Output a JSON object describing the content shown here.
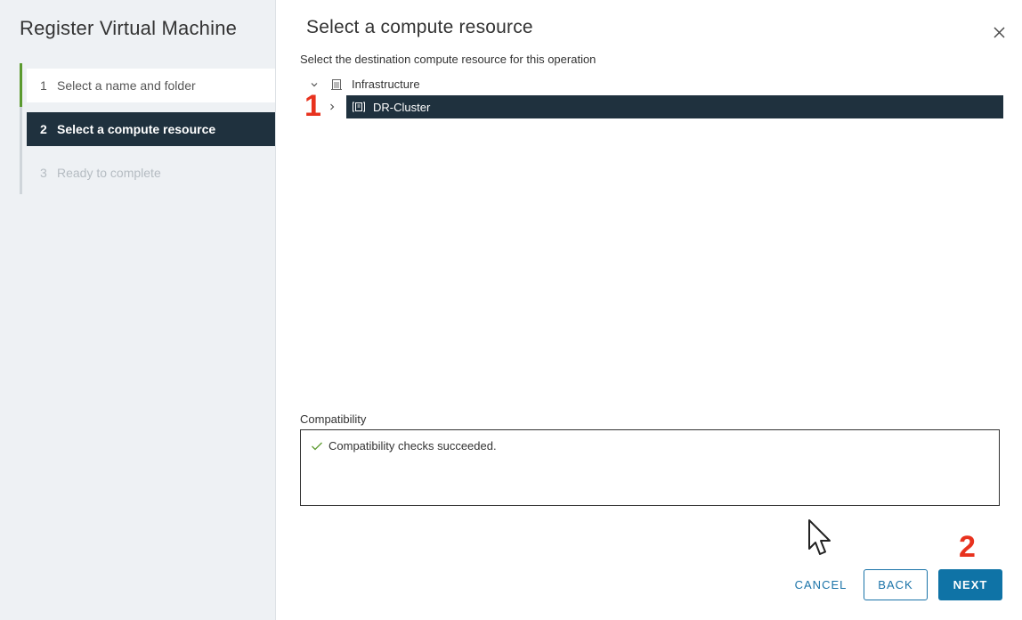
{
  "sidebar": {
    "title": "Register Virtual Machine",
    "steps": [
      {
        "num": "1",
        "label": "Select a name and folder"
      },
      {
        "num": "2",
        "label": "Select a compute resource"
      },
      {
        "num": "3",
        "label": "Ready to complete"
      }
    ]
  },
  "main": {
    "title": "Select a compute resource",
    "subtitle": "Select the destination compute resource for this operation",
    "tree": {
      "root_label": "Infrastructure",
      "child_label": "DR-Cluster"
    },
    "compatibility": {
      "label": "Compatibility",
      "message": "Compatibility checks succeeded."
    }
  },
  "annotations": {
    "marker_1": "1",
    "marker_2": "2"
  },
  "footer": {
    "cancel_label": "CANCEL",
    "back_label": "BACK",
    "next_label": "NEXT"
  },
  "colors": {
    "accent": "#0f73a6",
    "selected_bg": "#1f313e",
    "success": "#5b9a2f",
    "annotation": "#e8321e"
  },
  "icons": {
    "close": "close-icon",
    "root": "datacenter-icon",
    "child": "cluster-icon",
    "check": "check-icon"
  }
}
